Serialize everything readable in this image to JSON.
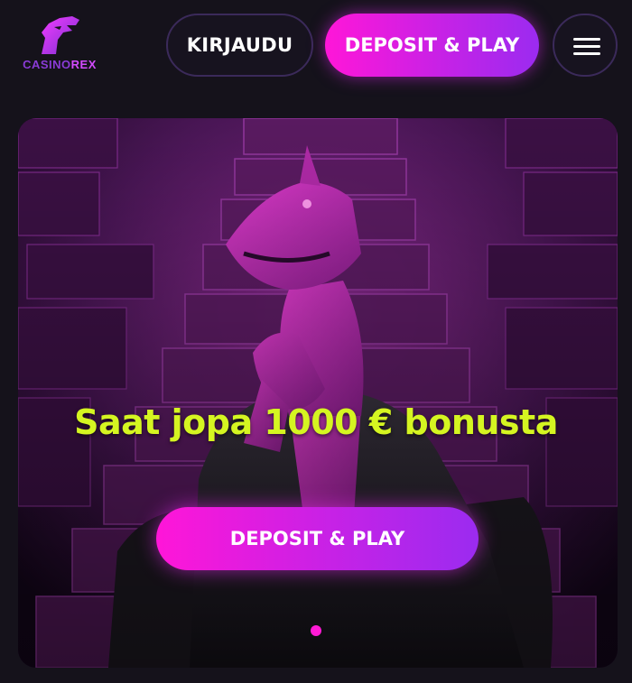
{
  "header": {
    "logo_text_part1": "CASINO",
    "logo_text_part2": "REX",
    "login_label": "KIRJAUDU",
    "deposit_label": "DEPOSIT & PLAY",
    "menu_icon": "hamburger-menu-icon"
  },
  "hero": {
    "promo_text": "Saat jopa 1000 € bonusta",
    "deposit_label": "DEPOSIT & PLAY",
    "slides": [
      {
        "active": true
      }
    ]
  },
  "colors": {
    "background": "#15121b",
    "accent_magenta": "#ff16d8",
    "accent_purple": "#9b2bf0",
    "promo_yellow": "#d5f521",
    "dot_active": "#ff1ad5"
  }
}
